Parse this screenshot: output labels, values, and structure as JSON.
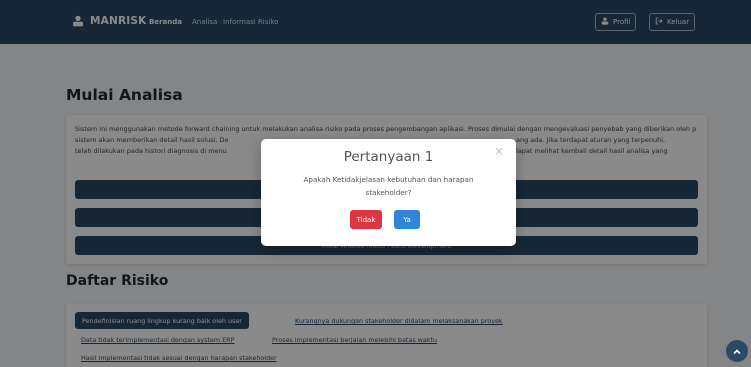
{
  "navbar": {
    "brand": "MANRISK",
    "links": [
      "Beranda",
      "Analisa",
      "Informasi Risiko"
    ],
    "profile_label": "Profil",
    "logout_label": "Keluar"
  },
  "main": {
    "title": "Mulai Analisa",
    "description": "Sistem ini menggunakan metode forward chaining untuk melakukan analisa risiko pada proses pengembangan aplikasi. Proses dimulai dengan mengevaluasi penyebab yang diberikan oleh p",
    "description_right_1": "ang ada. Jika terdapat aturan yang terpenuhi,",
    "description_line3_left": "sistem akan memberikan detail hasil solusi. De",
    "description_right_2": "lapat melihat kembali detail hasil analisa yang",
    "description_line4": "telah dilakukan pada histori diagnosis di menu",
    "menu_button_3": "Mulai Analisa Risiko Pasca Development"
  },
  "risks": {
    "title": "Daftar Risiko",
    "items": [
      "Pendefinisian ruang lingkup kurang baik oleh user",
      "Kurangnya dukungan stakeholder didalam melaksanakan proyek",
      "Data tidak terimplementasi dengan system ERP",
      "Proses implementasi berjalan melebihi batas waktu",
      "Hasil implementasi tidak sesuai dengan harapan stakeholder"
    ]
  },
  "modal": {
    "title": "Pertanyaan 1",
    "close": "×",
    "question": "Apakah Ketidakjelasan kebutuhan dan harapan stakeholder?",
    "no_label": "Tidak",
    "yes_label": "Ya"
  },
  "icons": {
    "brand": "user-icon",
    "profile": "user-icon",
    "logout": "logout-icon",
    "scroll_top": "chevron-up-icon"
  },
  "colors": {
    "navbar": "#2c4964",
    "danger": "#dc3741",
    "primary": "#3085d6"
  }
}
